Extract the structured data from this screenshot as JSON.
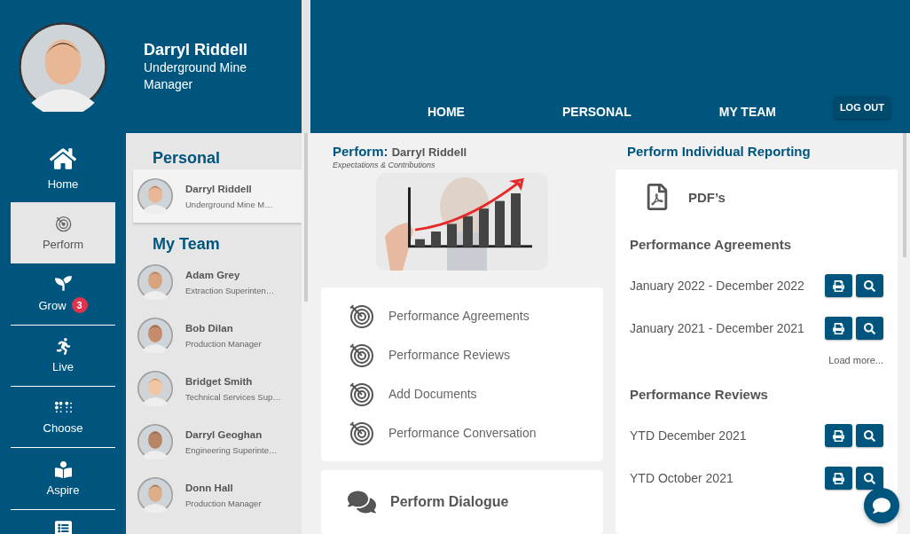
{
  "profile": {
    "name": "Darryl Riddell",
    "title": "Underground Mine Manager"
  },
  "nav": {
    "items": [
      {
        "label": "HOME"
      },
      {
        "label": "PERSONAL"
      },
      {
        "label": "MY TEAM"
      }
    ],
    "logout": "LOG OUT"
  },
  "rail": [
    {
      "label": "Home",
      "selected": false
    },
    {
      "label": "Perform",
      "selected": true
    },
    {
      "label": "Grow",
      "selected": false,
      "badge": "3"
    },
    {
      "label": "Live",
      "selected": false
    },
    {
      "label": "Choose",
      "selected": false
    },
    {
      "label": "Aspire",
      "selected": false
    },
    {
      "selected": false
    }
  ],
  "people": {
    "personal_heading": "Personal",
    "personal": [
      {
        "name": "Darryl Riddell",
        "role": "Underground Mine M…",
        "selected": true
      }
    ],
    "team_heading": "My Team",
    "team": [
      {
        "name": "Adam Grey",
        "role": "Extraction Superinten…",
        "selected": false
      },
      {
        "name": "Bob Dilan",
        "role": "Production Manager",
        "selected": false
      },
      {
        "name": "Bridget Smith",
        "role": "Technical Services Sup…",
        "selected": false
      },
      {
        "name": "Darryl Geoghan",
        "role": "Engineering Superinte…",
        "selected": false
      },
      {
        "name": "Donn Hall",
        "role": "Production Manager",
        "selected": false
      }
    ]
  },
  "perform": {
    "title_prefix": "Perform:",
    "title_name": "Darryl Riddell",
    "subtitle": "Expectations & Contributions",
    "links": [
      "Performance Agreements",
      "Performance Reviews",
      "Add Documents",
      "Performance Conversation"
    ],
    "dialogue": "Perform Dialogue"
  },
  "reporting": {
    "heading": "Perform Individual Reporting",
    "pdf_label": "PDF’s",
    "sections": [
      {
        "heading": "Performance Agreements",
        "rows": [
          "January 2022 - December 2022",
          "January 2021 - December 2021"
        ],
        "load_more": "Load more..."
      },
      {
        "heading": "Performance Reviews",
        "rows": [
          "YTD December 2021",
          "YTD October 2021"
        ]
      }
    ]
  }
}
